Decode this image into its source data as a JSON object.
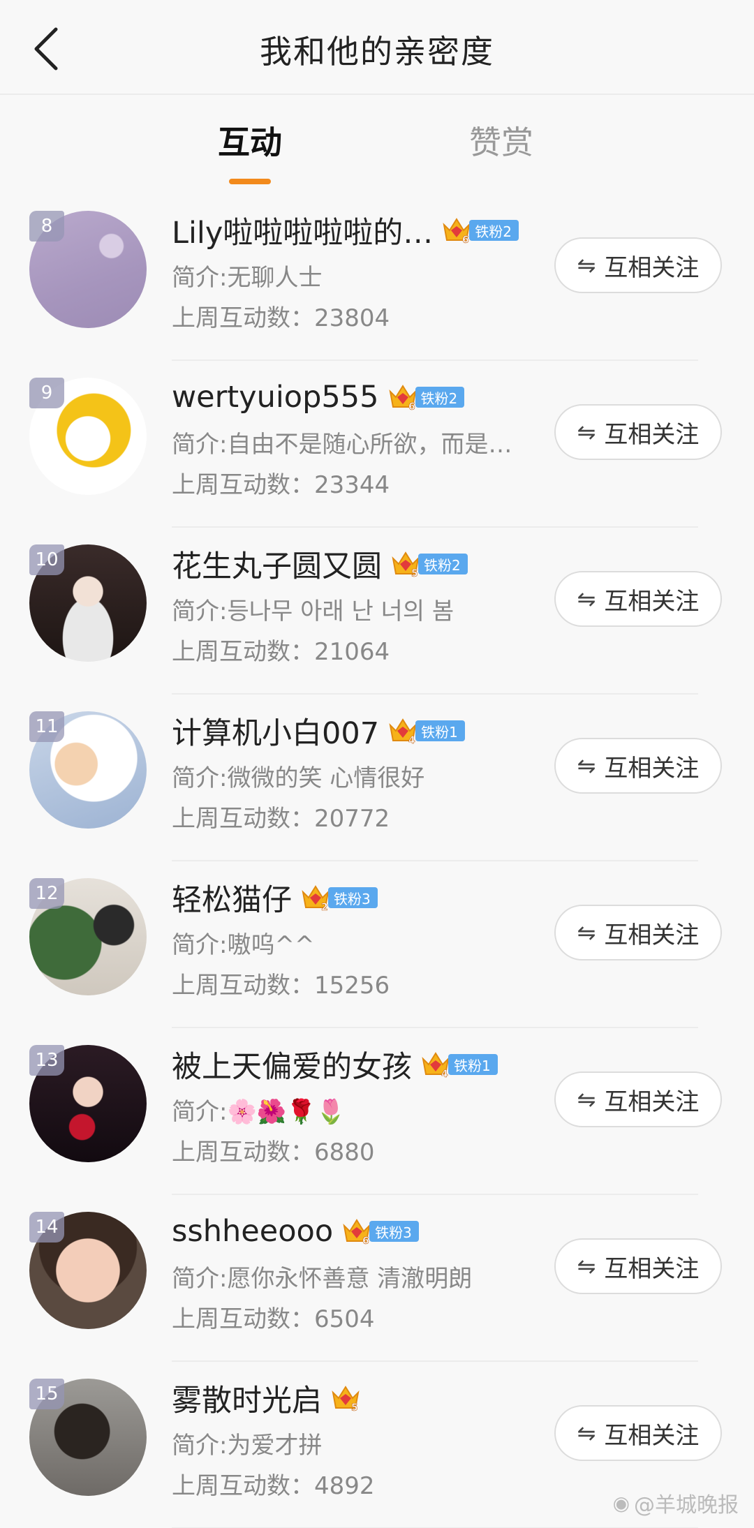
{
  "header": {
    "title": "我和他的亲密度",
    "back_icon": "chevron-left-icon"
  },
  "tabs": [
    {
      "label": "互动",
      "active": true
    },
    {
      "label": "赞赏",
      "active": false
    }
  ],
  "colors": {
    "accent": "#f28a1c",
    "fan_tag": "#5aa8ee",
    "crown": "#f6b21a"
  },
  "rows": [
    {
      "rank": "8",
      "name": "Lily啦啦啦啦啦的…",
      "crown_level": "6",
      "fan_label": "铁粉2",
      "bio": "简介:无聊人士",
      "count_label": "上周互动数：",
      "count": "23804",
      "button": "互相关注"
    },
    {
      "rank": "9",
      "name": "wertyuiop555",
      "crown_level": "6",
      "fan_label": "铁粉2",
      "bio": "简介:自由不是随心所欲，而是…",
      "count_label": "上周互动数：",
      "count": "23344",
      "button": "互相关注"
    },
    {
      "rank": "10",
      "name": "花生丸子圆又圆",
      "crown_level": "5",
      "fan_label": "铁粉2",
      "bio": "简介:등나무 아래 난 너의 봄",
      "count_label": "上周互动数：",
      "count": "21064",
      "button": "互相关注"
    },
    {
      "rank": "11",
      "name": "计算机小白007",
      "crown_level": "4",
      "fan_label": "铁粉1",
      "bio": "简介:微微的笑 心情很好",
      "count_label": "上周互动数：",
      "count": "20772",
      "button": "互相关注"
    },
    {
      "rank": "12",
      "name": "轻松猫仔",
      "crown_level": "2",
      "fan_label": "铁粉3",
      "bio": "简介:嗷呜^^",
      "count_label": "上周互动数：",
      "count": "15256",
      "button": "互相关注"
    },
    {
      "rank": "13",
      "name": "被上天偏爱的女孩",
      "crown_level": "4",
      "fan_label": "铁粉1",
      "bio": "简介:🌸🌺🌹🌷",
      "count_label": "上周互动数：",
      "count": "6880",
      "button": "互相关注"
    },
    {
      "rank": "14",
      "name": "sshheeooo",
      "crown_level": "6",
      "fan_label": "铁粉3",
      "bio": "简介:愿你永怀善意 清澈明朗",
      "count_label": "上周互动数：",
      "count": "6504",
      "button": "互相关注"
    },
    {
      "rank": "15",
      "name": "雾散时光启",
      "crown_level": "5",
      "fan_label": "",
      "bio": "简介:为爱才拼",
      "count_label": "上周互动数：",
      "count": "4892",
      "button": "互相关注"
    }
  ],
  "watermark": "@羊城晚报"
}
